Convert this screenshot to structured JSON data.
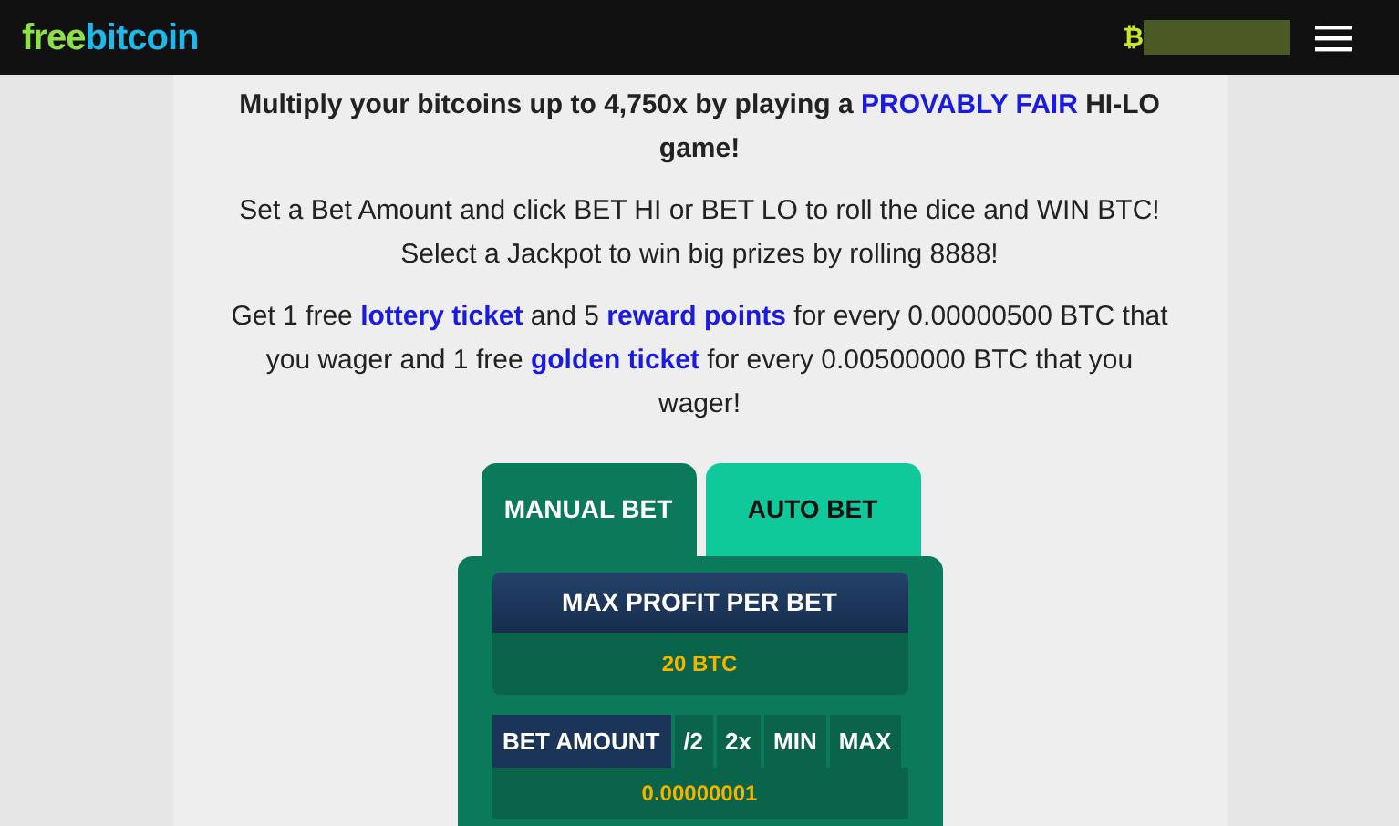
{
  "header": {
    "logo": [
      {
        "text": "free",
        "color": "#8ee04a"
      },
      {
        "text": "bitcoin",
        "color": "#1fb8ec"
      }
    ],
    "currency_icon": "₿"
  },
  "intro": [
    {
      "bold": true,
      "parts": [
        {
          "kind": "text",
          "text": "Multiply your bitcoins up to 4,750x by playing a "
        },
        {
          "kind": "link",
          "text": "PROVABLY FAIR"
        },
        {
          "kind": "text",
          "text": " HI-LO game!"
        }
      ]
    },
    {
      "bold": false,
      "parts": [
        {
          "kind": "text",
          "text": "Set a Bet Amount and click BET HI or BET LO to roll the dice and WIN BTC! Select a Jackpot to win big prizes by rolling 8888!"
        }
      ]
    },
    {
      "bold": false,
      "parts": [
        {
          "kind": "text",
          "text": "Get 1 free "
        },
        {
          "kind": "link",
          "text": "lottery ticket"
        },
        {
          "kind": "text",
          "text": " and 5 "
        },
        {
          "kind": "link",
          "text": "reward points"
        },
        {
          "kind": "text",
          "text": " for every 0.00000500 BTC that you wager and 1 free "
        },
        {
          "kind": "link",
          "text": "golden ticket"
        },
        {
          "kind": "text",
          "text": " for every 0.00500000 BTC that you wager!"
        }
      ]
    }
  ],
  "tabs": [
    {
      "label": "MANUAL BET",
      "selected": true
    },
    {
      "label": "AUTO BET",
      "selected": false
    }
  ],
  "max_profit": {
    "label": "MAX PROFIT PER BET",
    "value": "20 BTC"
  },
  "bet_amount": {
    "label": "BET AMOUNT",
    "buttons": [
      "/2",
      "2x",
      "MIN",
      "MAX"
    ],
    "value": "0.00000001"
  }
}
